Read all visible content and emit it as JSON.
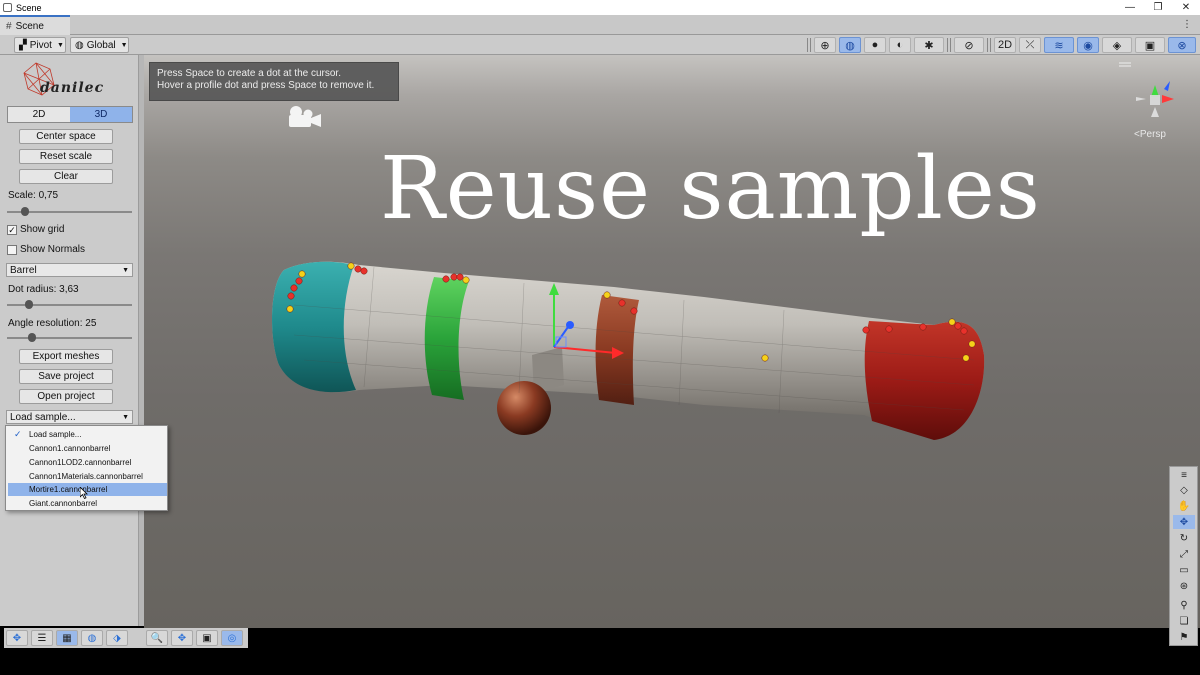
{
  "window": {
    "title": "Scene",
    "controls": [
      "—",
      "❐",
      "✕"
    ]
  },
  "tab": {
    "label": "Scene",
    "menu": "⋮"
  },
  "toolbar": {
    "pivot_label": "Pivot",
    "global_label": "Global",
    "icons": [
      "⊕",
      "◍",
      "●",
      "◐",
      "✱",
      "⊘",
      "2D",
      "⤫",
      "≋",
      "◉",
      "◈",
      "▣",
      "⊗"
    ]
  },
  "panel": {
    "logo_text": "danilec",
    "mode": {
      "two_d": "2D",
      "three_d": "3D",
      "selected": "3D"
    },
    "buttons": {
      "center_space": "Center space",
      "reset_scale": "Reset scale",
      "clear": "Clear",
      "export_meshes": "Export meshes",
      "save_project": "Save project",
      "open_project": "Open project"
    },
    "scale_label": "Scale: 0,75",
    "scale_fraction": 0.12,
    "show_grid": {
      "label": "Show grid",
      "checked": true,
      "mark": "✓"
    },
    "show_normals": {
      "label": "Show Normals",
      "checked": false,
      "mark": ""
    },
    "shape_select": "Barrel",
    "dot_radius_label": "Dot radius: 3,63",
    "dot_radius_fraction": 0.15,
    "angle_label": "Angle resolution: 25",
    "angle_fraction": 0.18,
    "load_select": "Load sample..."
  },
  "dropdown": {
    "items": [
      {
        "label": "Load sample...",
        "checked": true
      },
      {
        "label": "Cannon1.cannonbarrel",
        "checked": false
      },
      {
        "label": "Cannon1LOD2.cannonbarrel",
        "checked": false
      },
      {
        "label": "Cannon1Materials.cannonbarrel",
        "checked": false
      },
      {
        "label": "Mortire1.cannonbarrel",
        "checked": false,
        "highlighted": true
      },
      {
        "label": "Giant.cannonbarrel",
        "checked": false
      }
    ],
    "check_mark": "✓"
  },
  "viewport": {
    "tooltip_line1": "Press Space to create a dot at the cursor.",
    "tooltip_line2": "Hover a profile dot and press Space to remove it.",
    "persp_label": "<Persp",
    "overlay_title": "Reuse samples",
    "gizmo_labels": [
      "y",
      "x",
      "z"
    ],
    "colors": {
      "teal": "#1f8a8c",
      "green": "#2aa33a",
      "rust": "#8a3a22",
      "red": "#9c1b16",
      "steel": "#b9b6b0",
      "dot_red": "#e8312b",
      "dot_yellow": "#f5d21a"
    }
  },
  "bottom_left_icons": [
    "✥",
    "☰",
    "▦",
    "◍",
    "⬗"
  ],
  "bottom_mid_icons": [
    "🔍",
    "✥",
    "▣",
    "◎"
  ],
  "right_tools": [
    "≡",
    "◇",
    "✋",
    "✥",
    "↻",
    "⤢",
    "▭",
    "⊛",
    "⚲",
    "❏",
    "⚑"
  ]
}
